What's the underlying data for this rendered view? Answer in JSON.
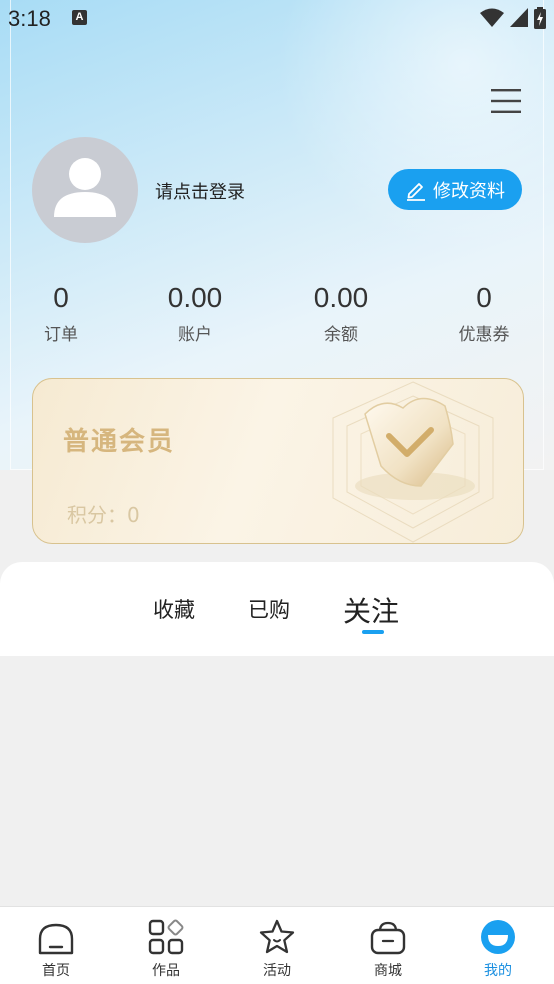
{
  "status_bar": {
    "time": "3:18",
    "indicator": "A"
  },
  "header": {
    "menu_icon": "hamburger-icon"
  },
  "profile": {
    "login_prompt": "请点击登录",
    "edit_button": "修改资料",
    "avatar_icon": "person-placeholder-icon"
  },
  "stats": [
    {
      "value": "0",
      "label": "订单"
    },
    {
      "value": "0.00",
      "label": "账户"
    },
    {
      "value": "0.00",
      "label": "余额"
    },
    {
      "value": "0",
      "label": "优惠券"
    }
  ],
  "member_card": {
    "level": "普通会员",
    "points": "积分：0"
  },
  "tabs": [
    {
      "label": "收藏",
      "active": false
    },
    {
      "label": "已购",
      "active": false
    },
    {
      "label": "关注",
      "active": true
    }
  ],
  "bottom_nav": [
    {
      "label": "首页",
      "icon": "home-icon",
      "active": false
    },
    {
      "label": "作品",
      "icon": "grid-icon",
      "active": false
    },
    {
      "label": "活动",
      "icon": "star-icon",
      "active": false
    },
    {
      "label": "商城",
      "icon": "basket-icon",
      "active": false
    },
    {
      "label": "我的",
      "icon": "profile-icon",
      "active": true
    }
  ],
  "colors": {
    "accent": "#1aa0f0",
    "member_gold": "#d6b67e",
    "nav_active": "#1a8fe0"
  }
}
